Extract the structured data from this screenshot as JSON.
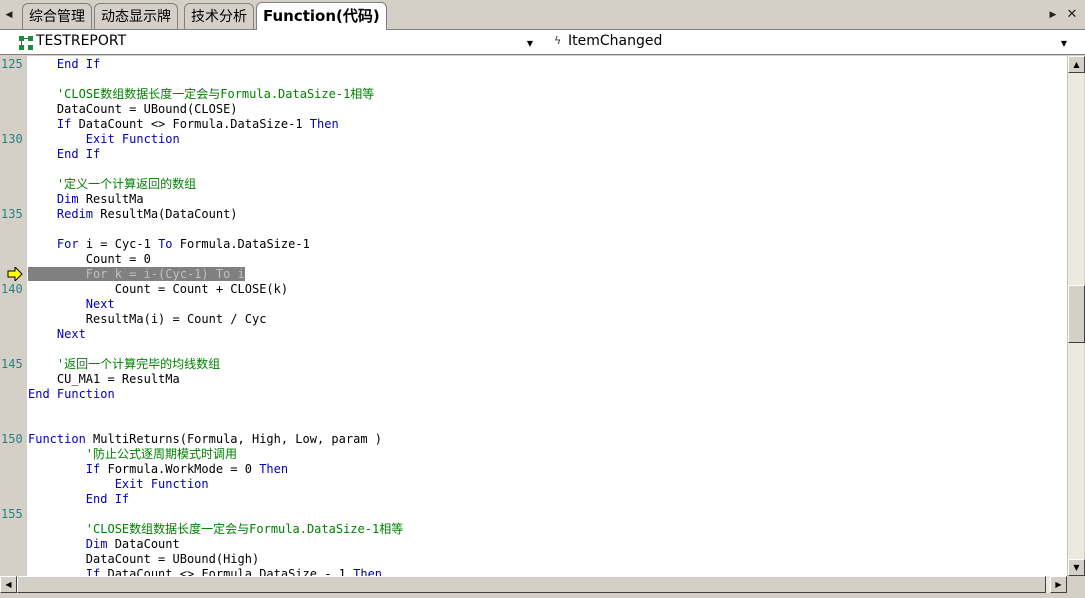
{
  "tabs": [
    "综合管理",
    "动态显示牌",
    "技术分析",
    "Function(代码)"
  ],
  "active_tab_index": 3,
  "object_dropdown": {
    "value": "TESTREPORT"
  },
  "event_dropdown": {
    "value": "ItemChanged"
  },
  "icons": {
    "tab_scroll_left": "triangle-left-icon",
    "tab_scroll_right": "triangle-right-icon",
    "tab_close": "close-icon",
    "object": "object-tree-icon",
    "event": "lightning-icon",
    "exec_arrow": "execution-pointer-arrow-icon"
  },
  "colors": {
    "keyword": "#0000c0",
    "comment": "#008000",
    "line_number": "#2a8080",
    "highlight_bg": "#808080",
    "highlight_fg": "#c0c0c0",
    "exec_arrow": "#ffff00"
  },
  "code": [
    {
      "ln": "125",
      "spans": [
        [
          "    ",
          ""
        ],
        [
          "End If",
          "kw"
        ]
      ]
    },
    {
      "ln": "",
      "spans": []
    },
    {
      "ln": "",
      "spans": [
        [
          "    ",
          ""
        ],
        [
          "'CLOSE数组数据长度一定会与Formula.DataSize-1相等",
          "cm"
        ]
      ]
    },
    {
      "ln": "",
      "spans": [
        [
          "    DataCount = UBound(CLOSE)",
          ""
        ]
      ]
    },
    {
      "ln": "",
      "spans": [
        [
          "    ",
          ""
        ],
        [
          "If",
          "kw"
        ],
        [
          " DataCount <> Formula.DataSize-1 ",
          ""
        ],
        [
          "Then",
          "kw"
        ]
      ]
    },
    {
      "ln": "130",
      "spans": [
        [
          "        ",
          ""
        ],
        [
          "Exit Function",
          "kw"
        ]
      ]
    },
    {
      "ln": "",
      "spans": [
        [
          "    ",
          ""
        ],
        [
          "End If",
          "kw"
        ]
      ]
    },
    {
      "ln": "",
      "spans": []
    },
    {
      "ln": "",
      "spans": [
        [
          "    ",
          ""
        ],
        [
          "'定义一个计算返回的数组",
          "cm"
        ]
      ]
    },
    {
      "ln": "",
      "spans": [
        [
          "    ",
          ""
        ],
        [
          "Dim",
          "kw"
        ],
        [
          " ResultMa",
          ""
        ]
      ]
    },
    {
      "ln": "135",
      "spans": [
        [
          "    ",
          ""
        ],
        [
          "Redim",
          "kw"
        ],
        [
          " ResultMa(DataCount)",
          ""
        ]
      ]
    },
    {
      "ln": "",
      "spans": []
    },
    {
      "ln": "",
      "spans": [
        [
          "    ",
          ""
        ],
        [
          "For",
          "kw"
        ],
        [
          " i = Cyc-1 ",
          ""
        ],
        [
          "To",
          "kw"
        ],
        [
          " Formula.DataSize-1",
          ""
        ]
      ]
    },
    {
      "ln": "",
      "spans": [
        [
          "        Count = 0",
          ""
        ]
      ]
    },
    {
      "ln": "",
      "spans": [
        [
          "        For k = i-(Cyc-1) To i",
          "hl"
        ]
      ]
    },
    {
      "ln": "140",
      "spans": [
        [
          "            Count = Count + CLOSE(k)",
          ""
        ]
      ]
    },
    {
      "ln": "",
      "spans": [
        [
          "        ",
          ""
        ],
        [
          "Next",
          "kw"
        ]
      ]
    },
    {
      "ln": "",
      "spans": [
        [
          "        ResultMa(i) = Count / Cyc",
          ""
        ]
      ]
    },
    {
      "ln": "",
      "spans": [
        [
          "    ",
          ""
        ],
        [
          "Next",
          "kw"
        ]
      ]
    },
    {
      "ln": "",
      "spans": []
    },
    {
      "ln": "145",
      "spans": [
        [
          "    ",
          ""
        ],
        [
          "'返回一个计算完毕的均线数组",
          "cm"
        ]
      ]
    },
    {
      "ln": "",
      "spans": [
        [
          "    CU_MA1 = ResultMa",
          ""
        ]
      ]
    },
    {
      "ln": "",
      "spans": [
        [
          "End Function",
          "kw"
        ]
      ]
    },
    {
      "ln": "",
      "spans": []
    },
    {
      "ln": "",
      "spans": []
    },
    {
      "ln": "150",
      "spans": [
        [
          "Function",
          "kw"
        ],
        [
          " MultiReturns(Formula, High, Low, param )",
          ""
        ]
      ]
    },
    {
      "ln": "",
      "spans": [
        [
          "        ",
          ""
        ],
        [
          "'防止公式逐周期模式时调用",
          "cm"
        ]
      ]
    },
    {
      "ln": "",
      "spans": [
        [
          "        ",
          ""
        ],
        [
          "If",
          "kw"
        ],
        [
          " Formula.WorkMode = 0 ",
          ""
        ],
        [
          "Then",
          "kw"
        ]
      ]
    },
    {
      "ln": "",
      "spans": [
        [
          "            ",
          ""
        ],
        [
          "Exit Function",
          "kw"
        ]
      ]
    },
    {
      "ln": "",
      "spans": [
        [
          "        ",
          ""
        ],
        [
          "End If",
          "kw"
        ]
      ]
    },
    {
      "ln": "155",
      "spans": []
    },
    {
      "ln": "",
      "spans": [
        [
          "        ",
          ""
        ],
        [
          "'CLOSE数组数据长度一定会与Formula.DataSize-1相等",
          "cm"
        ]
      ]
    },
    {
      "ln": "",
      "spans": [
        [
          "        ",
          ""
        ],
        [
          "Dim",
          "kw"
        ],
        [
          " DataCount",
          ""
        ]
      ]
    },
    {
      "ln": "",
      "spans": [
        [
          "        DataCount = UBound(High)",
          ""
        ]
      ]
    },
    {
      "ln": "",
      "spans": [
        [
          "        ",
          ""
        ],
        [
          "If",
          "kw"
        ],
        [
          " DataCount <> Formula.DataSize - 1 ",
          ""
        ],
        [
          "Then",
          "kw"
        ]
      ]
    }
  ]
}
